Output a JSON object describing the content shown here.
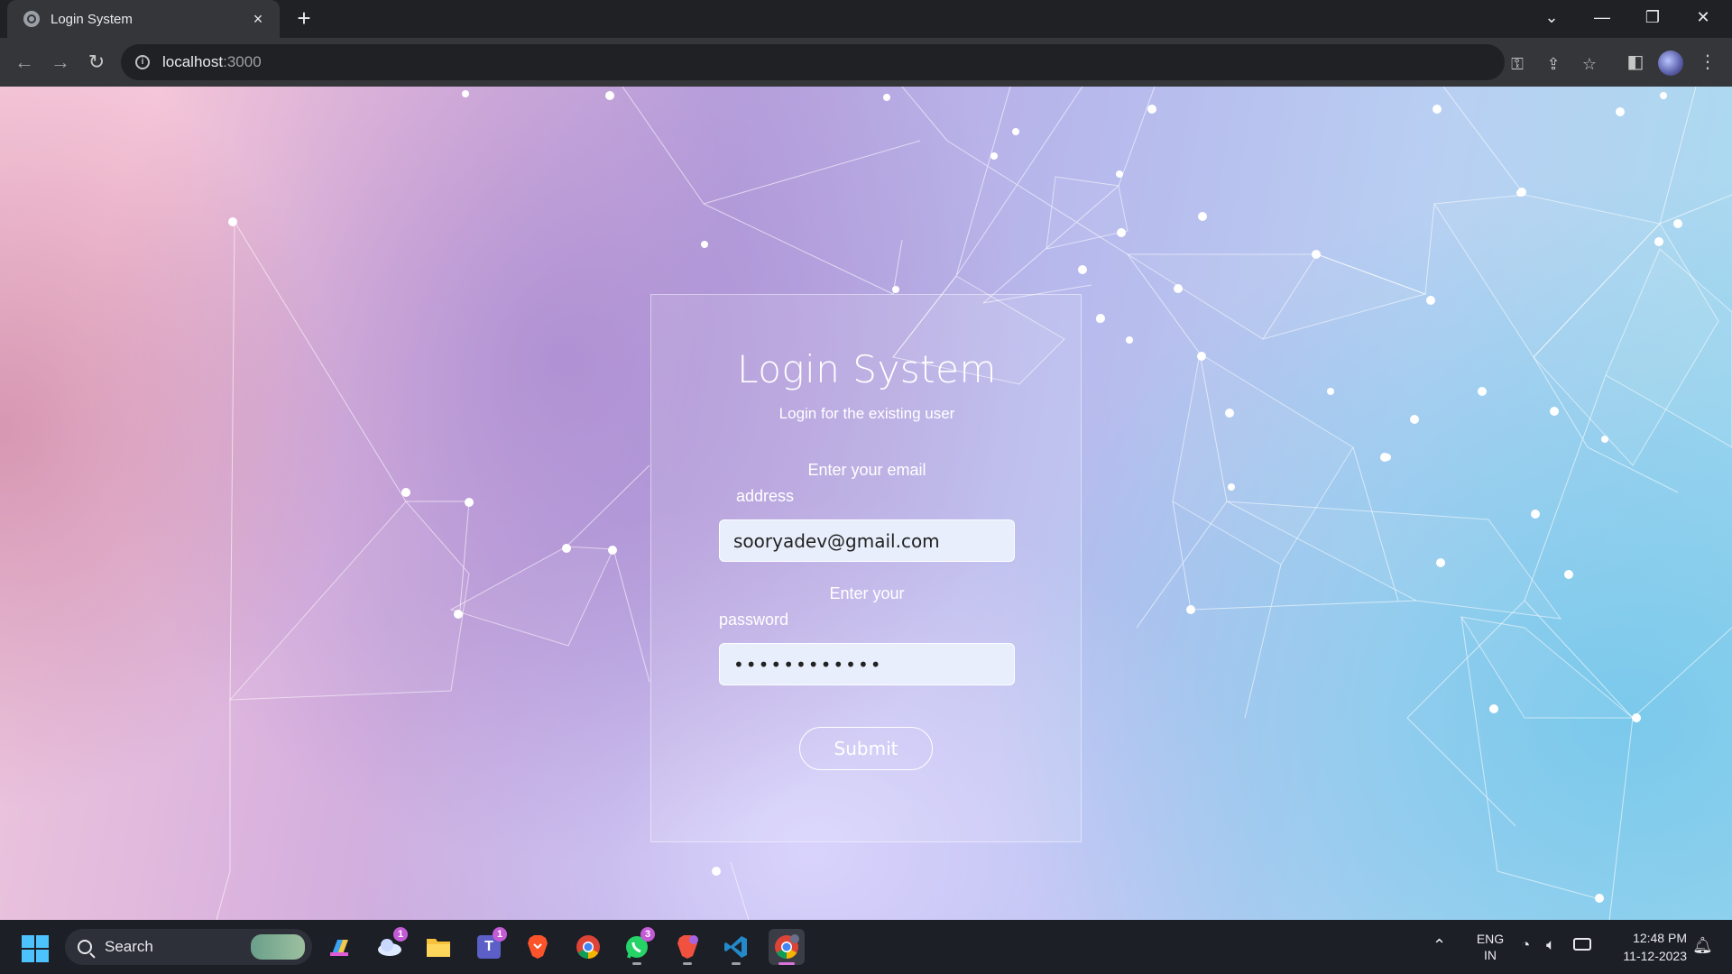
{
  "browser": {
    "tab_title": "Login System",
    "tab_close": "×",
    "new_tab": "+",
    "url_host": "localhost",
    "url_port": ":3000",
    "window_controls": [
      "minimize",
      "restore",
      "close"
    ]
  },
  "login": {
    "title": "Login System",
    "subtitle": "Login for the existing user",
    "email_label_line1": "Enter your email",
    "email_label_line2": "address",
    "email_value": "sooryadev@gmail.com",
    "password_label_line1": "Enter your",
    "password_label_line2": "password",
    "password_value": "mypassword12",
    "submit_label": "Submit"
  },
  "taskbar": {
    "search_placeholder": "Search",
    "apps": [
      {
        "name": "copilot-icon"
      },
      {
        "name": "weather-icon",
        "badge": "1"
      },
      {
        "name": "file-explorer-icon"
      },
      {
        "name": "teams-icon",
        "badge": "1",
        "letter": "T"
      },
      {
        "name": "brave-icon"
      },
      {
        "name": "chrome-icon"
      },
      {
        "name": "whatsapp-icon",
        "badge": "3"
      },
      {
        "name": "brave-beta-icon"
      },
      {
        "name": "vscode-icon"
      },
      {
        "name": "chrome-dev-icon"
      }
    ],
    "language_line1": "ENG",
    "language_line2": "IN",
    "time": "12:48 PM",
    "date": "11-12-2023"
  },
  "colors": {
    "accent_start": "#4cc2ff",
    "card_border": "#ffffff",
    "input_bg": "#e8eefb"
  }
}
